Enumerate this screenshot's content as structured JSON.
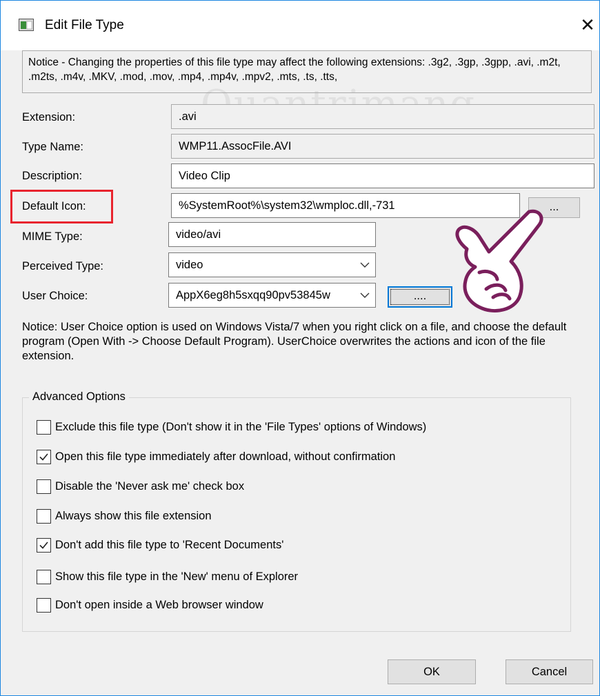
{
  "window": {
    "title": "Edit File Type",
    "accent": "#0078d7"
  },
  "notice_top": "Notice - Changing the properties of this file type may affect the following extensions: .3g2, .3gp, .3gpp, .avi, .m2t, .m2ts, .m4v, .MKV, .mod, .mov, .mp4, .mp4v, .mpv2, .mts, .ts, .tts,",
  "fields": {
    "extension": {
      "label": "Extension:",
      "value": ".avi"
    },
    "type_name": {
      "label": "Type Name:",
      "value": "WMP11.AssocFile.AVI"
    },
    "description": {
      "label": "Description:",
      "value": "Video Clip"
    },
    "default_icon": {
      "label": "Default Icon:",
      "value": "%SystemRoot%\\system32\\wmploc.dll,-731",
      "button": "..."
    },
    "mime_type": {
      "label": "MIME Type:",
      "value": "video/avi"
    },
    "perceived_type": {
      "label": "Perceived Type:",
      "value": "video"
    },
    "user_choice": {
      "label": "User Choice:",
      "value": "AppX6eg8h5sxqq90pv53845w",
      "button": "...."
    }
  },
  "notice_user_choice": "Notice: User Choice option is used on Windows Vista/7 when you right click on a file, and choose the default program (Open With -> Choose Default Program). UserChoice overwrites the actions and icon of the file extension.",
  "advanced": {
    "title": "Advanced Options",
    "options": [
      {
        "label": "Exclude  this file type (Don't show it in the 'File Types' options of Windows)",
        "checked": false
      },
      {
        "label": "Open this file type immediately after download, without confirmation",
        "checked": true
      },
      {
        "label": "Disable the 'Never ask me' check box",
        "checked": false
      },
      {
        "label": "Always show this file extension",
        "checked": false
      },
      {
        "label": "Don't add this file type to 'Recent Documents'",
        "checked": true
      },
      {
        "label": "Show this file type in the 'New' menu of Explorer",
        "checked": false
      },
      {
        "label": "Don't open inside a Web browser window",
        "checked": false
      }
    ]
  },
  "buttons": {
    "ok": "OK",
    "cancel": "Cancel"
  },
  "highlight_color": "#e8242e"
}
